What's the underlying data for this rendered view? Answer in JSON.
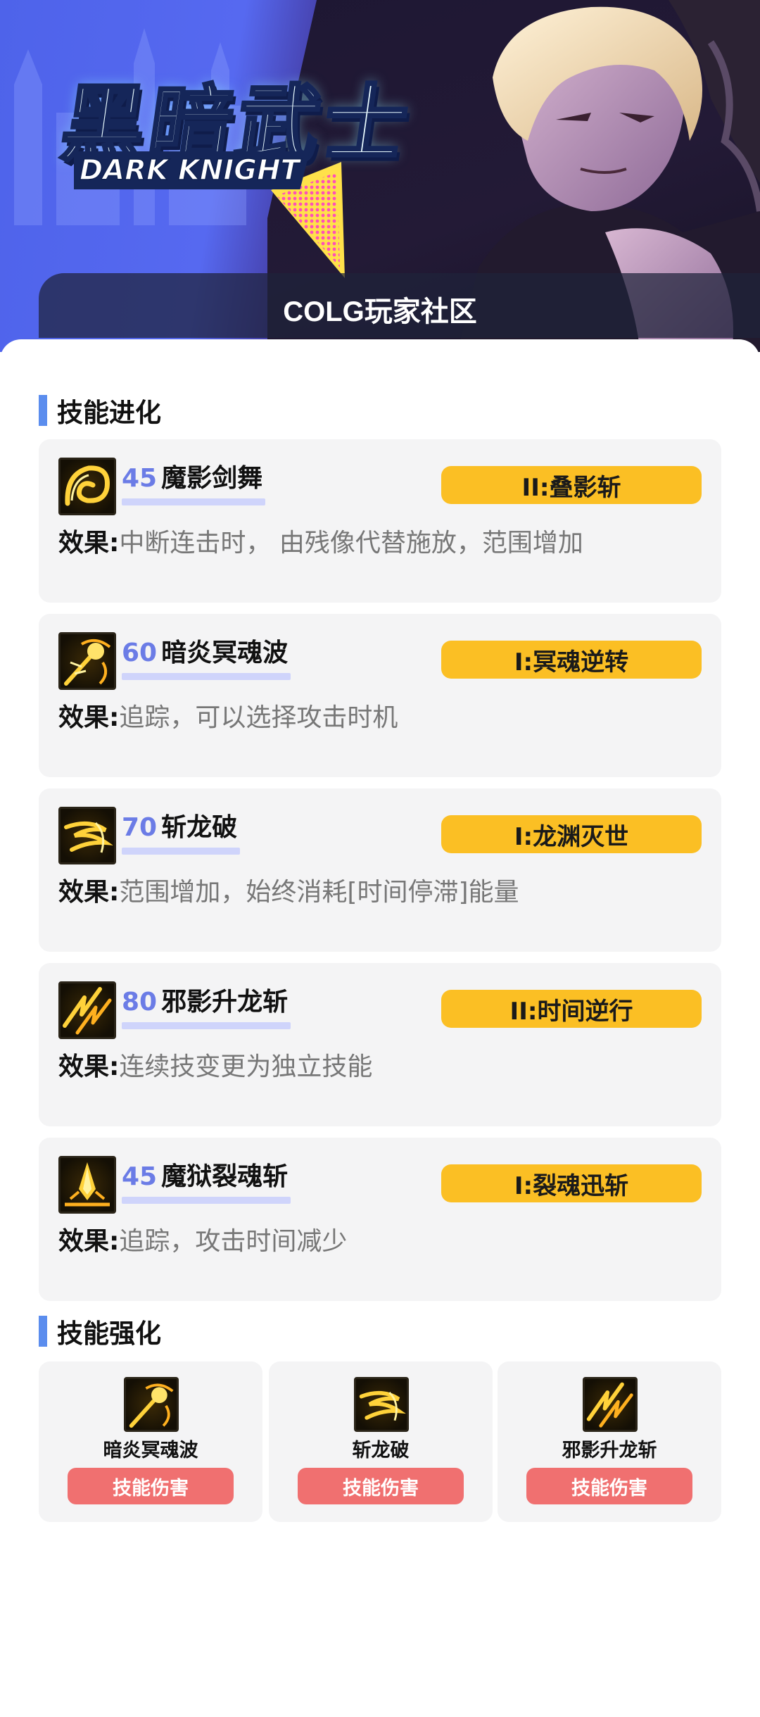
{
  "hero": {
    "title_cn": "黑暗武士",
    "title_en": "DARK KNIGHT",
    "community": "COLG玩家社区"
  },
  "sections": {
    "evolution_title": "技能进化",
    "enhancement_title": "技能强化"
  },
  "effect_label": "效果:",
  "evolutions": [
    {
      "level": "45",
      "name": "魔影剑舞",
      "evolution": "II:叠影斩",
      "effect": "中断连击时， 由残像代替施放，范围增加",
      "icon": "spiral-slash-icon"
    },
    {
      "level": "60",
      "name": "暗炎冥魂波",
      "evolution": "I:冥魂逆转",
      "effect": "追踪，可以选择攻击时机",
      "icon": "flame-wave-icon"
    },
    {
      "level": "70",
      "name": "斩龙破",
      "evolution": "I:龙渊灭世",
      "effect": "范围增加，始终消耗[时间停滞]能量",
      "icon": "dragon-slash-icon"
    },
    {
      "level": "80",
      "name": "邪影升龙斩",
      "evolution": "II:时间逆行",
      "effect": "连续技变更为独立技能",
      "icon": "rising-slash-icon"
    },
    {
      "level": "45",
      "name": "魔狱裂魂斩",
      "evolution": "I:裂魂迅斩",
      "effect": "追踪，攻击时间减少",
      "icon": "ground-blade-icon"
    }
  ],
  "enhancements": [
    {
      "name": "暗炎冥魂波",
      "button": "技能伤害",
      "icon": "flame-wave-icon"
    },
    {
      "name": "斩龙破",
      "button": "技能伤害",
      "icon": "dragon-slash-icon"
    },
    {
      "name": "邪影升龙斩",
      "button": "技能伤害",
      "icon": "rising-slash-icon"
    }
  ],
  "colors": {
    "accent_blue": "#5b8dee",
    "level_blue": "#6b7ce6",
    "badge_yellow": "#fbbf24",
    "button_red": "#f07070",
    "card_bg": "#f4f4f5"
  }
}
